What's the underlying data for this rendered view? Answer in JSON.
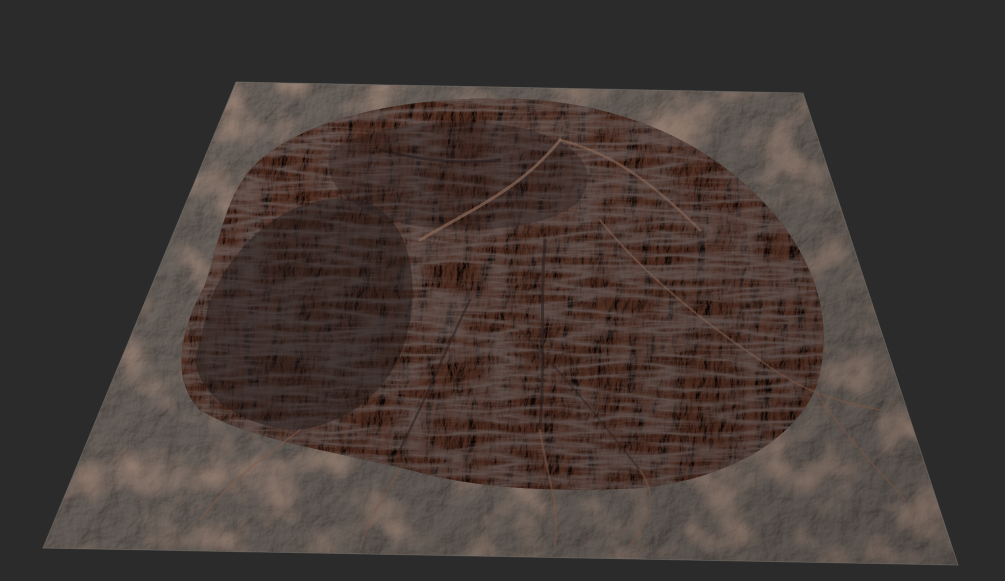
{
  "viewport": {
    "background_color": "#2b2b2b"
  },
  "terrain": {
    "subject": "3d-terrain-heightmap-render",
    "colors": {
      "lowland_base": "#8a8480",
      "lowland_light": "#b3aca6",
      "lowland_shadow": "#5f5a57",
      "rust_accent": "#9a6a52",
      "highland_rock": "#6e4e43",
      "highland_dark": "#2e2524",
      "ridge_highlight": "#a07a66"
    }
  }
}
